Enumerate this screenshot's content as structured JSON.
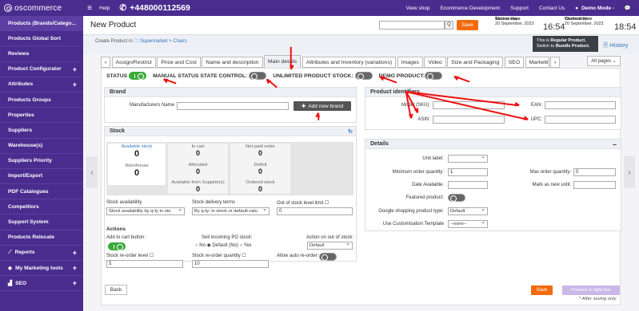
{
  "topbar": {
    "logo": "oscommerce",
    "help": "Help",
    "phone": "+448000112569",
    "links": [
      "View shop",
      "Ecommerce Development",
      "Support",
      "Contact Us"
    ],
    "user": "Demo Mode -"
  },
  "sidebar": {
    "items": [
      {
        "label": "Products (Brands/Catego...",
        "plus": false
      },
      {
        "label": "Products Global Sort",
        "plus": false
      },
      {
        "label": "Reviews",
        "plus": false
      },
      {
        "label": "Product Configurator",
        "plus": true
      },
      {
        "label": "Attributes",
        "plus": true
      },
      {
        "label": "Products Groups",
        "plus": false
      },
      {
        "label": "Properties",
        "plus": false
      },
      {
        "label": "Suppliers",
        "plus": false
      },
      {
        "label": "Warehouse(s)",
        "plus": false
      },
      {
        "label": "Suppliers Priority",
        "plus": false
      },
      {
        "label": "Import/Export",
        "plus": false
      },
      {
        "label": "PDF Catalogues",
        "plus": false
      },
      {
        "label": "Competitors",
        "plus": false
      },
      {
        "label": "Support System",
        "plus": false
      },
      {
        "label": "Products Relocate",
        "plus": false
      },
      {
        "label": "Reports",
        "plus": true
      },
      {
        "label": "My Marketing tools",
        "plus": true
      },
      {
        "label": "SEO",
        "plus": true
      }
    ]
  },
  "header": {
    "title": "New Product",
    "save": "Save",
    "search_icon": "Q",
    "server": {
      "label": "Server time",
      "day": "Wednesday",
      "date": "20 September, 2023",
      "time": "16:54"
    },
    "current": {
      "label": "Current time",
      "day": "Wednesday",
      "date": "20 September, 2023",
      "time": "18:54"
    }
  },
  "breadcrumb": {
    "prefix": "Create Product in",
    "path": "Supermarket > Chairs"
  },
  "tooltip": {
    "line1_pre": "This is ",
    "line1_b": "Regular Product.",
    "line2_pre": "Switch to ",
    "line2_b": "Bundle Product."
  },
  "history": "History",
  "tabs": [
    "Assign/Restrict",
    "Price and Cost",
    "Name and description",
    "Main details",
    "Attributes and Inventory (variations)",
    "Images",
    "Video",
    "Size and Packaging",
    "SEO",
    "Marketing"
  ],
  "all_pages": "All pages",
  "status_row": {
    "status": "STATUS",
    "manual": "MANUAL STATUS STATE CONTROL:",
    "unlimited": "UNLIMITED PRODUCT STOCK:",
    "demo": "DEMO PRODUCT:"
  },
  "brand": {
    "title": "Brand",
    "manufacturers_label": "Manufacturers Name",
    "add_button": "Add new brand"
  },
  "identifiers": {
    "title": "Product identifiers",
    "model": "Model (SKU):",
    "ean": "EAN:",
    "asin": "ASIN:",
    "upc": "UPC:"
  },
  "stock": {
    "title": "Stock",
    "cells": [
      {
        "label": "Available stock",
        "value": "0"
      },
      {
        "label": "In cart",
        "value": "0"
      },
      {
        "label": "Not paid order",
        "value": "0"
      },
      {
        "label": "Warehouse",
        "value": "0"
      },
      {
        "label": "Allocated",
        "value": "0"
      },
      {
        "label": "Deficit",
        "value": "0"
      },
      {
        "label": "Available from Supplier(s)",
        "value": "0"
      },
      {
        "label": "Ordered stock",
        "value": "0"
      }
    ],
    "availability_label": "Stock availability",
    "availability_value": "Stock availability by q-ty in sto",
    "delivery_label": "Stock delivery terms",
    "delivery_value": "By q-ty: in stock or default valu",
    "limit_label": "Out of stock level limit",
    "limit_value": "0"
  },
  "actions": {
    "title": "Actions",
    "add_to_cart": "Add to cart button:",
    "sell_po": "Sell incoming PO stock:",
    "radio_no": "No",
    "radio_default": "Default (No)",
    "radio_yes": "Yes",
    "action_out": "Action on out of stock:",
    "action_value": "Default",
    "reorder_level": "Stock re-order level",
    "reorder_level_value": "5",
    "reorder_qty": "Stock re-order quantity",
    "reorder_qty_value": "10",
    "auto_reorder": "Allow auto re-order:"
  },
  "details": {
    "title": "Details",
    "unit_label": "Unit label:",
    "min_qty": "Minimum order quantity:",
    "min_qty_value": "1",
    "max_qty": "Max order quantity:",
    "max_qty_value": "0",
    "date_available": "Date Available:",
    "mark_new": "Mark as new until:",
    "featured": "Featured product:",
    "google_type": "Google shopping product type:",
    "google_value": "Default",
    "customisation": "Use Customisation Template",
    "customisation_value": "--none--"
  },
  "footer": {
    "back": "Back",
    "save": "Save",
    "preview": "Preview in light box",
    "note": "* After saving only"
  }
}
